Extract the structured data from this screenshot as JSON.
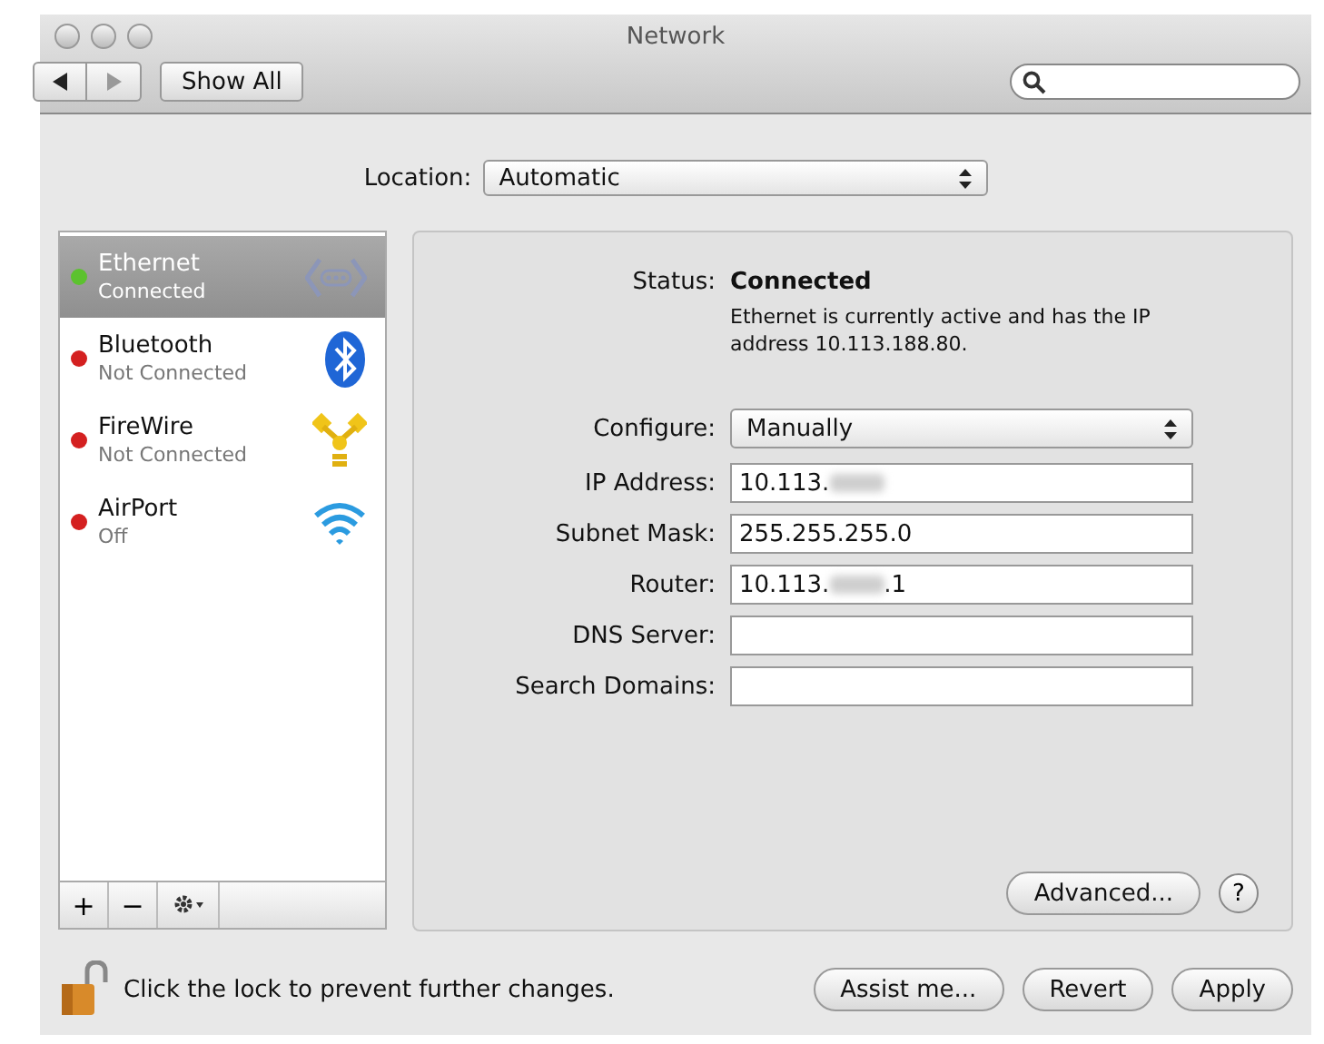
{
  "window": {
    "title": "Network"
  },
  "toolbar": {
    "show_all": "Show All"
  },
  "location": {
    "label": "Location:",
    "value": "Automatic"
  },
  "services": [
    {
      "name": "Ethernet",
      "status": "Connected",
      "color": "#5cc22e",
      "selected": true,
      "kind": "ethernet"
    },
    {
      "name": "Bluetooth",
      "status": "Not Connected",
      "color": "#d42020",
      "selected": false,
      "kind": "bluetooth"
    },
    {
      "name": "FireWire",
      "status": "Not Connected",
      "color": "#d42020",
      "selected": false,
      "kind": "firewire"
    },
    {
      "name": "AirPort",
      "status": "Off",
      "color": "#d42020",
      "selected": false,
      "kind": "airport"
    }
  ],
  "list_buttons": [
    "+",
    "−"
  ],
  "status": {
    "label": "Status:",
    "value": "Connected",
    "description": "Ethernet is currently active and has the IP address 10.113.188.80."
  },
  "fields": [
    {
      "label": "Configure:",
      "kind": "select",
      "value": "Manually"
    },
    {
      "label": "IP Address:",
      "kind": "text",
      "value": "10.113.",
      "blurred": true
    },
    {
      "label": "Subnet Mask:",
      "kind": "text",
      "value": "255.255.255.0"
    },
    {
      "label": "Router:",
      "kind": "text",
      "value": "10.113.",
      "blurred": true,
      "value_after": ".1"
    },
    {
      "label": "DNS Server:",
      "kind": "text"
    },
    {
      "label": "Search Domains:",
      "kind": "text"
    }
  ],
  "advanced": "Advanced...",
  "help": "?",
  "lock_text": "Click the lock to prevent further changes.",
  "buttons": [
    "Assist me...",
    "Revert",
    "Apply"
  ]
}
